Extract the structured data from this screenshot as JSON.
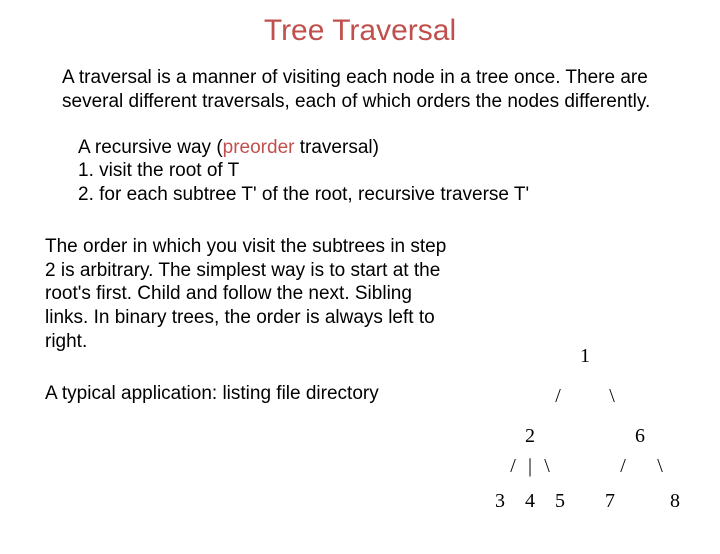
{
  "title": "Tree Traversal",
  "intro": "A traversal is a manner of visiting each node in a tree once. There are several different traversals, each of which orders the nodes differently.",
  "recursive": {
    "prefix": "A recursive way (",
    "highlight": "preorder",
    "suffix": " traversal)",
    "step1": "1. visit the root of T",
    "step2": "2. for each subtree T' of the root, recursive traverse T'"
  },
  "explain": "The order in which you visit the subtrees in step 2 is arbitrary. The simplest way is to start at the root's first. Child and follow the next. Sibling links. In binary trees, the order is always left to right.",
  "application": "A typical application: listing file directory",
  "tree": {
    "n1": "1",
    "n2": "2",
    "n3": "3",
    "n4": "4",
    "n5": "5",
    "n6": "6",
    "n7": "7",
    "n8": "8"
  }
}
